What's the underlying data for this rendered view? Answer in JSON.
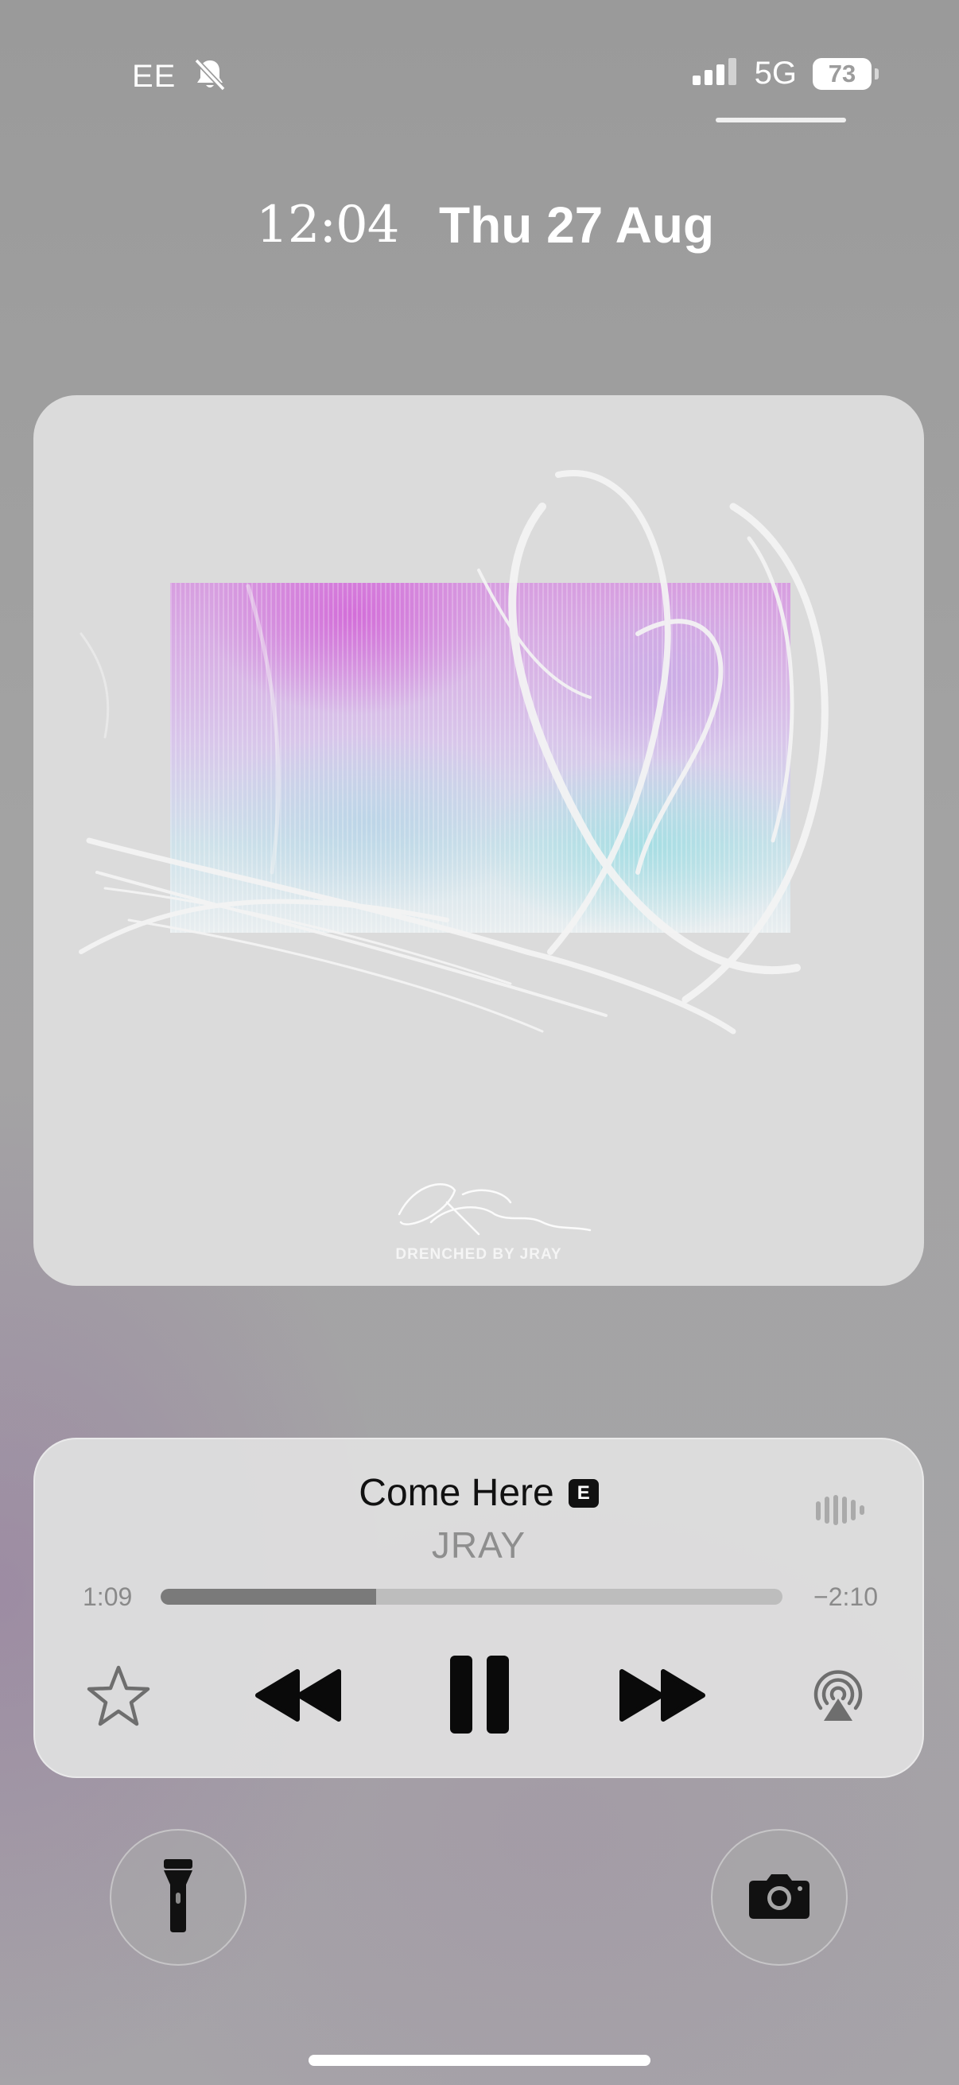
{
  "status_bar": {
    "carrier": "EE",
    "silent_icon": "bell-slash-icon",
    "signal_icon": "cellular-signal-icon",
    "network": "5G",
    "battery": "73"
  },
  "lock_screen": {
    "time": "12:04",
    "date": "Thu 27 Aug"
  },
  "artwork": {
    "caption": "DRENCHED BY JRAY"
  },
  "now_playing": {
    "title": "Come Here",
    "explicit_badge": "E",
    "artist": "JRAY",
    "elapsed": "1:09",
    "remaining": "−2:10",
    "progress": 0.347
  },
  "controls": {
    "favorite_icon": "star-icon",
    "previous_icon": "backward-icon",
    "play_pause_icon": "pause-icon",
    "next_icon": "forward-icon",
    "airplay_icon": "airplay-icon"
  },
  "quick_actions": {
    "left_icon": "flashlight-icon",
    "right_icon": "camera-icon"
  }
}
